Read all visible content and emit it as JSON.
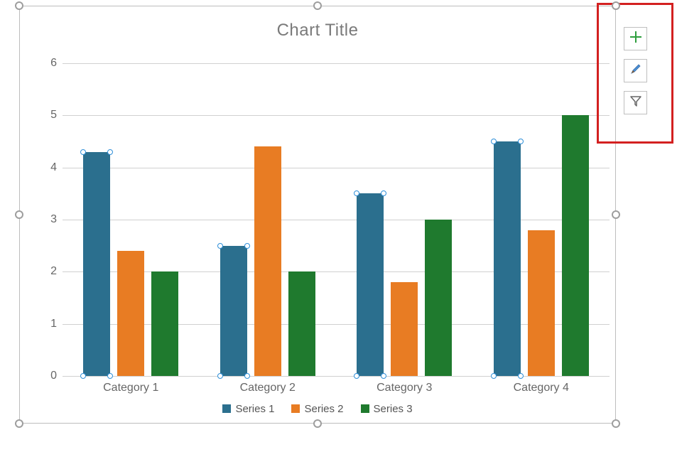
{
  "chart_data": {
    "type": "bar",
    "title": "Chart Title",
    "categories": [
      "Category 1",
      "Category 2",
      "Category 3",
      "Category 4"
    ],
    "series": [
      {
        "name": "Series 1",
        "color": "#2b6f8e",
        "values": [
          4.3,
          2.5,
          3.5,
          4.5
        ]
      },
      {
        "name": "Series 2",
        "color": "#e87c23",
        "values": [
          2.4,
          4.4,
          1.8,
          2.8
        ]
      },
      {
        "name": "Series 3",
        "color": "#1f7a2e",
        "values": [
          2.0,
          2.0,
          3.0,
          5.0
        ]
      }
    ],
    "xlabel": "",
    "ylabel": "",
    "ylim": [
      0,
      6
    ],
    "y_ticks": [
      0,
      1,
      2,
      3,
      4,
      5,
      6
    ],
    "grid": true,
    "legend_position": "bottom",
    "selected_series": "Series 1"
  },
  "tools": {
    "chart_elements": "Chart Elements",
    "chart_styles": "Chart Styles",
    "chart_filters": "Chart Filters"
  }
}
